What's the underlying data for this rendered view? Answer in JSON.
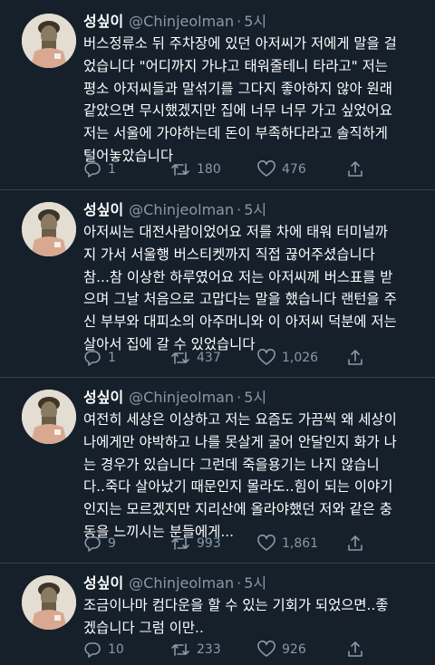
{
  "tweets": [
    {
      "name": "성싶이",
      "handle": "@Chinjeolman",
      "time": "5시",
      "text": "버스정류소 뒤 주차장에 있던 아저씨가 저에게 말을 걸\n었습니다 \"어디까지 가냐고 태워줄테니 타라고\" 저는\n평소 아저씨들과 말섞기를 그다지 좋아하지 않아 원래\n같았으면 무시했겠지만 집에 너무 너무 가고 싶었어요\n저는 서울에 가야하는데 돈이 부족하다라고 솔직하게\n털어놓았습니다",
      "replies": "1",
      "retweets": "180",
      "likes": "476"
    },
    {
      "name": "성싶이",
      "handle": "@Chinjeolman",
      "time": "5시",
      "text": "아저씨는 대전사람이었어요 저를 차에 태워 터미널까\n지 가서 서울행 버스티켓까지 직접 끊어주셨습니다\n참...참 이상한 하루였어요 저는 아저씨께 버스표를 받\n으며 그날 처음으로 고맙다는 말을 했습니다 랜턴을 주\n신 부부와 대피소의 아주머니와 이 아저씨 덕분에 저는\n살아서 집에 갈 수 있었습니다",
      "replies": "1",
      "retweets": "437",
      "likes": "1,026"
    },
    {
      "name": "성싶이",
      "handle": "@Chinjeolman",
      "time": "5시",
      "text": "여전히 세상은 이상하고 저는 요즘도 가끔씩 왜 세상이\n나에게만 야박하고 나를 못살게 굴어 안달인지 화가 나\n는 경우가 있습니다 그런데 죽을용기는 나지 않습니\n다..죽다 살아났기 때문인지 몰라도..힘이 되는 이야기\n인지는 모르겠지만 지리산에 올라야했던 저와 같은 충\n동을 느끼시는 분들에게...",
      "replies": "9",
      "retweets": "993",
      "likes": "1,861"
    },
    {
      "name": "성싶이",
      "handle": "@Chinjeolman",
      "time": "5시",
      "text": "조금이나마 컴다운을 할 수 있는 기회가 되었으면..좋\n겠습니다 그럼 이만..",
      "replies": "10",
      "retweets": "233",
      "likes": "926"
    }
  ],
  "icons": {
    "reply": "reply-icon",
    "retweet": "retweet-icon",
    "like": "heart-icon",
    "share": "share-icon"
  },
  "colors": {
    "background": "#15202b",
    "secondary_text": "#8899a6",
    "divider": "#38444d"
  }
}
